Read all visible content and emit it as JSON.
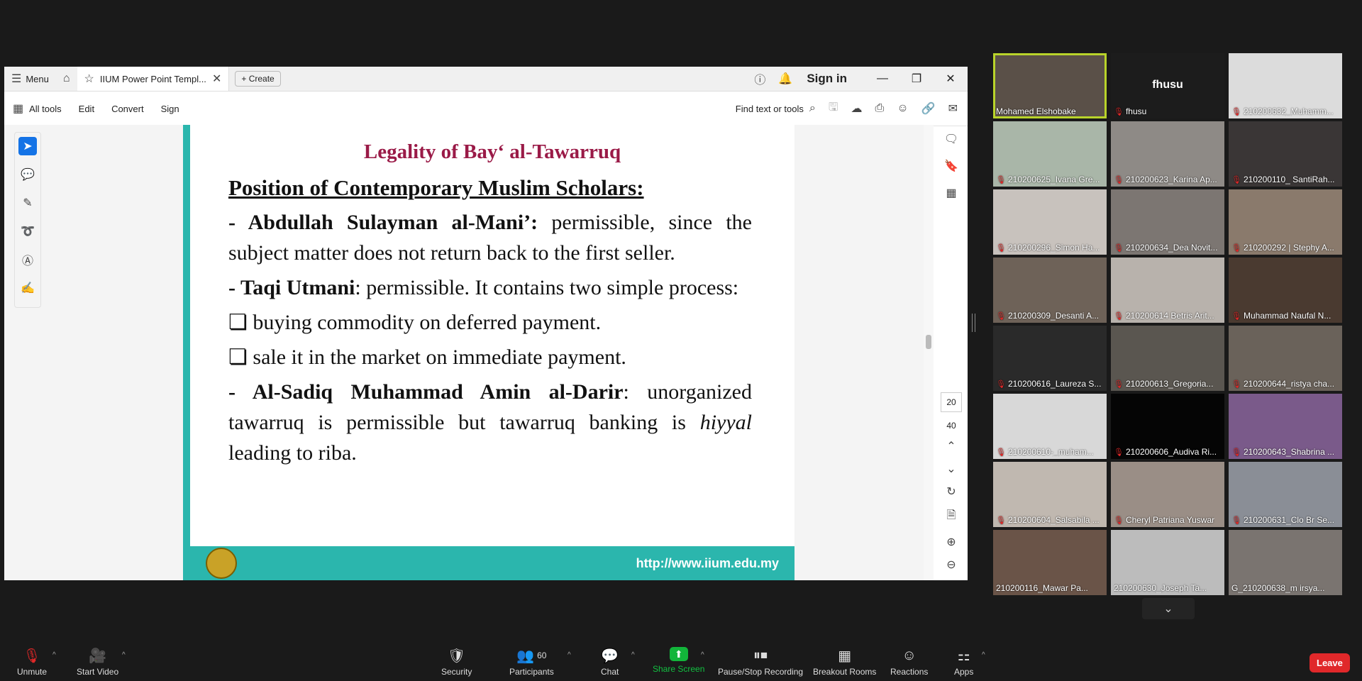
{
  "acrobat": {
    "menu_label": "Menu",
    "tab_title": "IIUM Power Point Templ...",
    "create_label": "Create",
    "signin_label": "Sign in",
    "tools": [
      "All tools",
      "Edit",
      "Convert",
      "Sign"
    ],
    "find_label": "Find text or tools",
    "page_current": "20",
    "page_total": "40"
  },
  "slide": {
    "title": "Legality of Bay‘ al-Tawarruq",
    "heading": "Position of Contemporary Muslim Scholars:",
    "p1_bold": "- Abdullah Sulayman al-Mani’:",
    "p1_text": " permissible, since the subject matter does not return back to the first seller.",
    "p2_bold": "- Taqi Utmani",
    "p2_text": ": permissible. It contains two simple process:",
    "b1": "buying commodity on deferred payment.",
    "b2": "sale it in the market on immediate payment.",
    "p3_bold": "- Al-Sadiq Muhammad Amin al-Darir",
    "p3_text": ": unorganized tawarruq is permissible but tawarruq banking is ",
    "p3_italic": "hiyyal",
    "p3_end": " leading to riba.",
    "footer_url": "http://www.iium.edu.my"
  },
  "gallery": {
    "participants": [
      {
        "name": "Mohamed Elshobake",
        "active": true,
        "muted": false
      },
      {
        "name": "fhusu",
        "muted": true,
        "big_label": "fhusu"
      },
      {
        "name": "210200632_Muhamm...",
        "muted": true
      },
      {
        "name": "210200625_Ivana Gre...",
        "muted": true
      },
      {
        "name": "210200623_Karina Ap...",
        "muted": true
      },
      {
        "name": "210200110_ SantiRah...",
        "muted": true
      },
      {
        "name": "210200296_Simon Ha...",
        "muted": true
      },
      {
        "name": "210200634_Dea Novit...",
        "muted": true
      },
      {
        "name": "210200292 | Stephy A...",
        "muted": true
      },
      {
        "name": "210200309_Desanti A...",
        "muted": true
      },
      {
        "name": "210200614 Betris Arit...",
        "muted": true
      },
      {
        "name": "Muhammad Naufal N...",
        "muted": true
      },
      {
        "name": "210200616_Laureza S...",
        "muted": true
      },
      {
        "name": "210200613_Gregoria...",
        "muted": true
      },
      {
        "name": "210200644_ristya cha...",
        "muted": true
      },
      {
        "name": "210200610-_muham...",
        "muted": true
      },
      {
        "name": "210200606_Audiva Ri...",
        "muted": true
      },
      {
        "name": "210200643_Shabrina ...",
        "muted": true
      },
      {
        "name": "210200604_Salsabila ...",
        "muted": true
      },
      {
        "name": "Cheryl Patriana Yuswar",
        "muted": true
      },
      {
        "name": "210200631_Clo Br Se...",
        "muted": true
      },
      {
        "name": "210200116_Mawar Pa...",
        "muted": false
      },
      {
        "name": "210200630_Joseph Ta...",
        "muted": false
      },
      {
        "name": "G_210200638_m irsya...",
        "muted": false
      }
    ]
  },
  "bottombar": {
    "unmute": "Unmute",
    "start_video": "Start Video",
    "security": "Security",
    "participants": "Participants",
    "participants_count": "60",
    "chat": "Chat",
    "share_screen": "Share Screen",
    "pause_recording": "Pause/Stop Recording",
    "breakout": "Breakout Rooms",
    "reactions": "Reactions",
    "apps": "Apps",
    "leave": "Leave"
  },
  "colors": {
    "slide_accent": "#2bb6ad",
    "title_color": "#9a1a47",
    "active_speaker": "#b9d42a",
    "share_green": "#12b53a",
    "leave_red": "#e0282a"
  }
}
